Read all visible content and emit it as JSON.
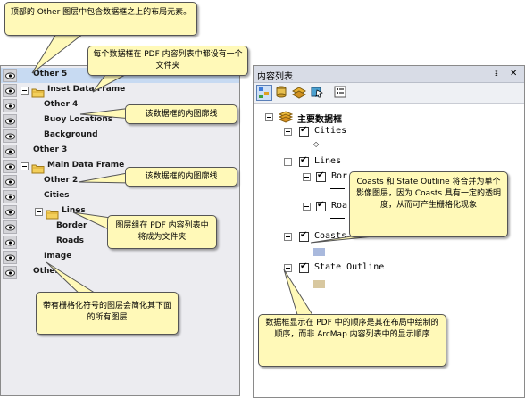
{
  "left_panel": {
    "rows": [
      {
        "label": "Other 5",
        "indent": 0,
        "folder": false,
        "toggle": false,
        "selected": true
      },
      {
        "label": "Inset Data Frame",
        "indent": 0,
        "folder": true,
        "toggle": true,
        "selected": false
      },
      {
        "label": "Other 4",
        "indent": 1,
        "folder": false,
        "toggle": false,
        "selected": false
      },
      {
        "label": "Buoy Locations",
        "indent": 1,
        "folder": false,
        "toggle": false,
        "selected": false
      },
      {
        "label": "Background",
        "indent": 1,
        "folder": false,
        "toggle": false,
        "selected": false
      },
      {
        "label": "Other 3",
        "indent": 0,
        "folder": false,
        "toggle": false,
        "selected": false
      },
      {
        "label": "Main Data Frame",
        "indent": 0,
        "folder": true,
        "toggle": true,
        "selected": false
      },
      {
        "label": "Other 2",
        "indent": 1,
        "folder": false,
        "toggle": false,
        "selected": false
      },
      {
        "label": "Cities",
        "indent": 1,
        "folder": false,
        "toggle": false,
        "selected": false
      },
      {
        "label": "Lines",
        "indent": 1,
        "folder": true,
        "toggle": true,
        "selected": false
      },
      {
        "label": "Border",
        "indent": 2,
        "folder": false,
        "toggle": false,
        "selected": false
      },
      {
        "label": "Roads",
        "indent": 2,
        "folder": false,
        "toggle": false,
        "selected": false
      },
      {
        "label": "Image",
        "indent": 1,
        "folder": false,
        "toggle": false,
        "selected": false
      },
      {
        "label": "Other",
        "indent": 0,
        "folder": false,
        "toggle": false,
        "selected": false
      }
    ]
  },
  "right_panel": {
    "title": "内容列表",
    "pin": "ᵻ",
    "close": "✕",
    "data_frame": "主要数据框",
    "layers": {
      "cities": "Cities",
      "lines": "Lines",
      "border": "Bor",
      "roads": "Roa",
      "coasts": "Coasts",
      "state_outline": "State Outline"
    },
    "colors": {
      "coasts_swatch": "#a9b9dd",
      "state_swatch": "#d8c8a0"
    }
  },
  "callouts": {
    "top": "顶部的 Other 图层中包含数据框之上的布局元素。",
    "folder_each": "每个数据框在 PDF 内容列表中都设有一个文件夹",
    "inset_outline": "该数据框的内图廓线",
    "main_outline": "该数据框的内图廓线",
    "group_folder": "图层组在 PDF 内容列表中将成为文件夹",
    "rasterize": "带有栅格化符号的图层会简化其下面的所有图层",
    "coasts_merge": "Coasts 和 State Outline 将合并为单个影像图层，因为 Coasts 具有一定的透明度，从而可产生栅格化现象",
    "order": "数据框显示在 PDF 中的顺序是其在布局中绘制的顺序，而非 ArcMap 内容列表中的显示顺序"
  }
}
